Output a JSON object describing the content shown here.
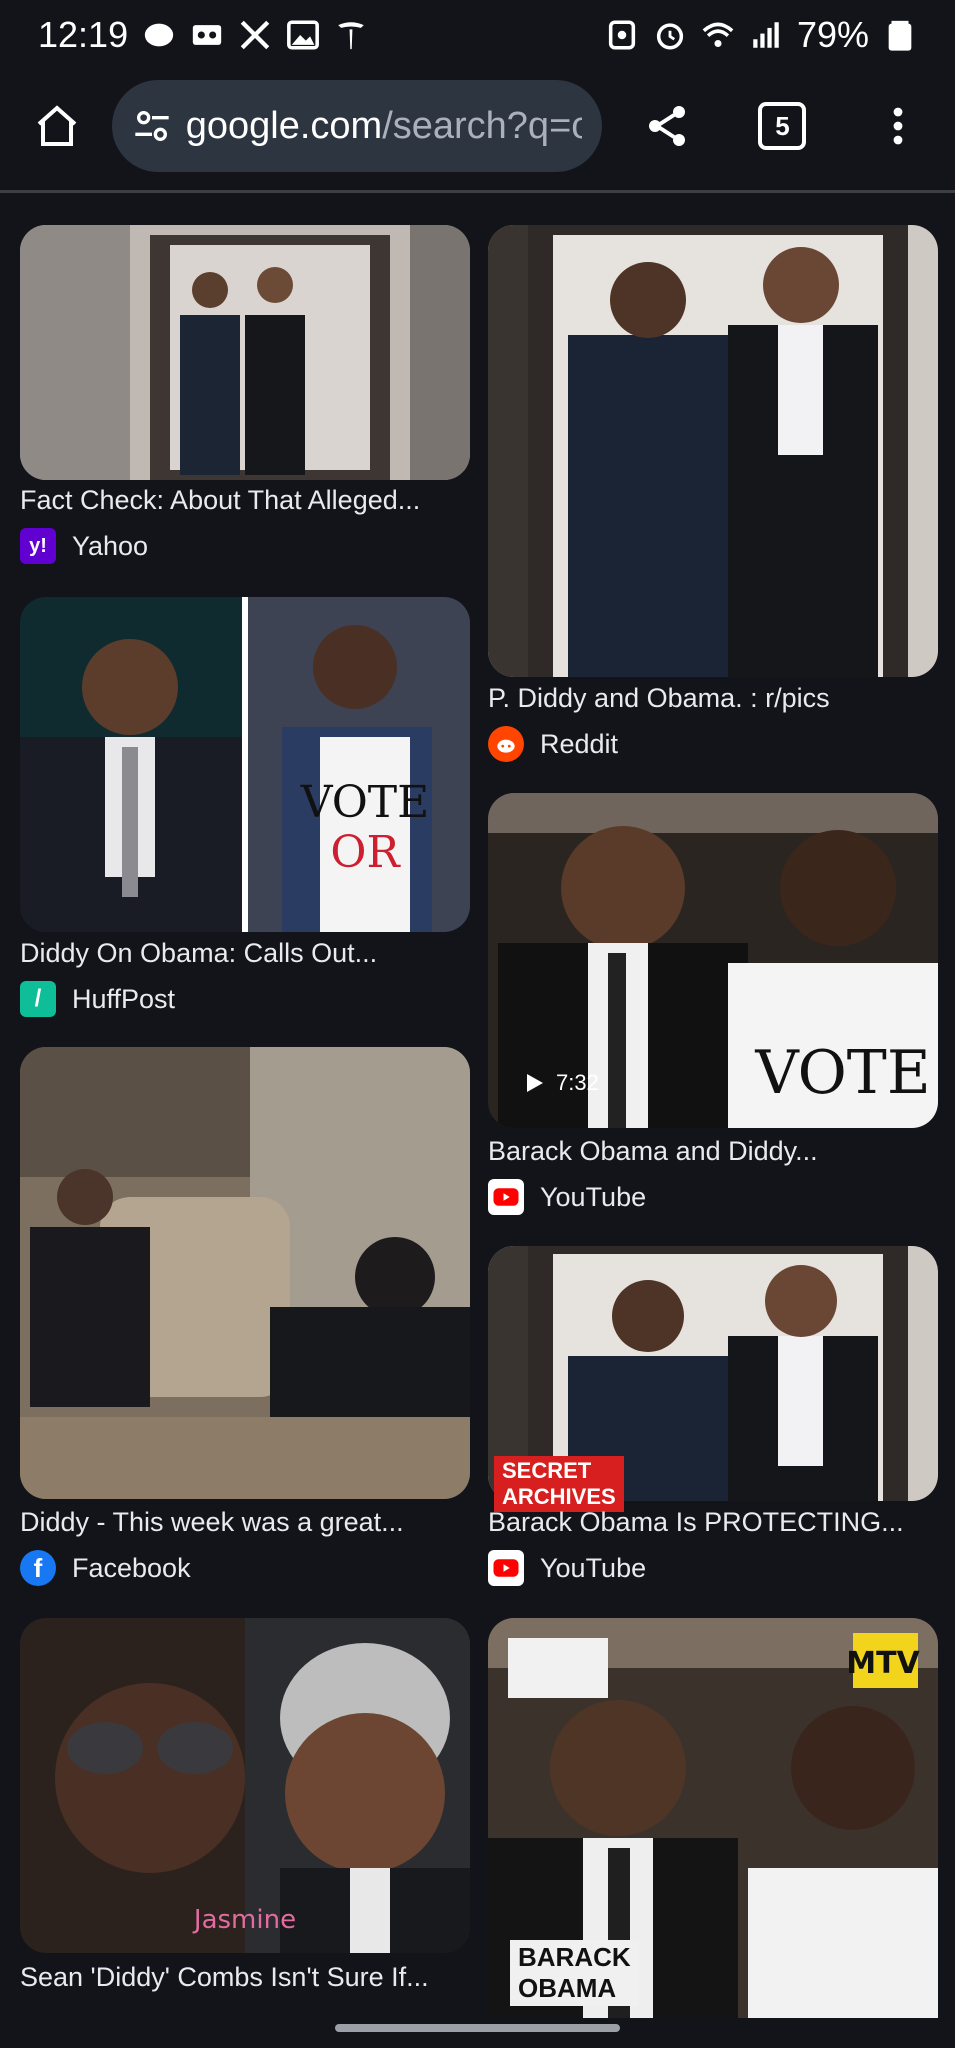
{
  "status_bar": {
    "time": "12:19",
    "battery": "79%",
    "left_icons": [
      "messages-icon",
      "voicemail-icon",
      "x-icon",
      "gallery-icon",
      "tesla-icon"
    ],
    "right_icons": [
      "nfc-icon",
      "alarm-icon",
      "wifi-icon",
      "signal-icon",
      "battery-icon"
    ]
  },
  "browser": {
    "url_domain": "google.com",
    "url_path": "/search?q=o",
    "tab_count": "5"
  },
  "results": [
    {
      "title": "Fact Check: About That Alleged...",
      "source": "Yahoo",
      "favicon_color": "#6001d2",
      "favicon_text": "y!"
    },
    {
      "title": "P. Diddy and Obama. : r/pics",
      "source": "Reddit",
      "favicon_color": "#ff4500",
      "favicon_text": ""
    },
    {
      "title": "Diddy On Obama: Calls Out...",
      "source": "HuffPost",
      "favicon_color": "#0dbe98",
      "favicon_text": "/"
    },
    {
      "title": "Barack Obama and Diddy...",
      "source": "YouTube",
      "favicon_color": "#ff0000",
      "favicon_text": "",
      "duration": "7:32"
    },
    {
      "title": "Diddy - This week was a great...",
      "source": "Facebook",
      "favicon_color": "#1877f2",
      "favicon_text": "f"
    },
    {
      "title": "Barack Obama Is PROTECTING...",
      "source": "YouTube",
      "favicon_color": "#ff0000",
      "favicon_text": "",
      "overlay": "SECRET ARCHIVES"
    },
    {
      "title": "Sean 'Diddy' Combs Isn't Sure If...",
      "source": "",
      "favicon_color": "#ffffff",
      "favicon_text": ""
    },
    {
      "title": "",
      "source": "",
      "favicon_color": "",
      "favicon_text": "",
      "overlay": "BARACK OBAMA"
    }
  ]
}
